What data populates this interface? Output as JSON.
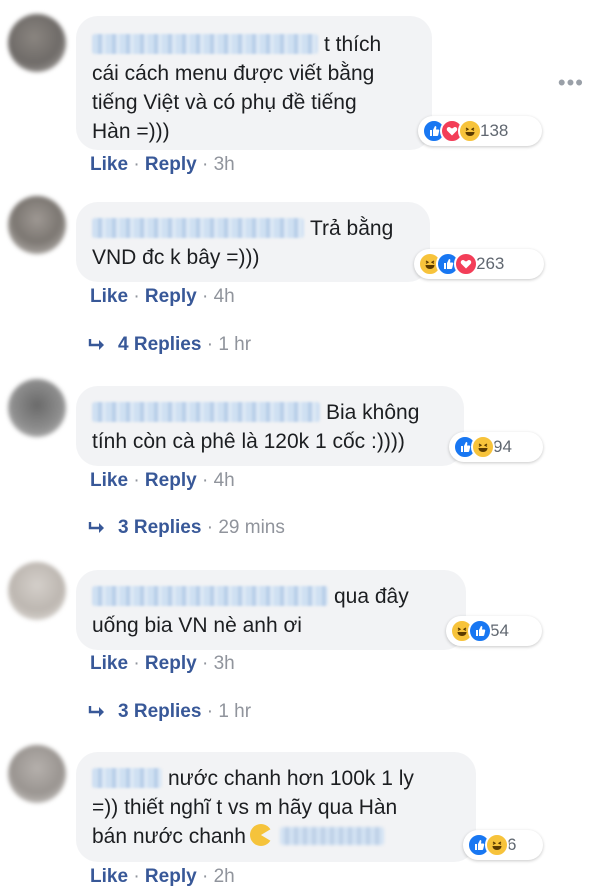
{
  "more_label": "•••",
  "comments": [
    {
      "text": "t thích cái cách menu được viết bằng tiếng Việt và có phụ đề tiếng Hàn =)))",
      "line1": "t thích",
      "line2": "cái cách menu được viết bằng",
      "line3": "tiếng Việt và có phụ đề tiếng",
      "line4": "Hàn =)))",
      "reaction_icons": [
        "like-icon",
        "love-icon",
        "haha-icon"
      ],
      "reaction_count": "138",
      "like_label": "Like",
      "reply_label": "Reply",
      "time": "3h"
    },
    {
      "text": "Trả bằng VND đc k bây =)))",
      "line1": "Trả bằng",
      "line2": "VND đc k bây =)))",
      "reaction_icons": [
        "haha-icon",
        "like-icon",
        "love-icon"
      ],
      "reaction_count": "263",
      "like_label": "Like",
      "reply_label": "Reply",
      "time": "4h",
      "replies_label": "4 Replies",
      "replies_time": "1 hr"
    },
    {
      "text": "Bia không tính còn cà phê là 120k 1 cốc :))))",
      "line1": "Bia không",
      "line2": "tính còn cà phê là 120k 1 cốc :))))",
      "reaction_icons": [
        "like-icon",
        "haha-icon"
      ],
      "reaction_count": "94",
      "like_label": "Like",
      "reply_label": "Reply",
      "time": "4h",
      "replies_label": "3 Replies",
      "replies_time": "29 mins"
    },
    {
      "text": "qua đây uống bia VN nè anh ơi",
      "line1": "qua đây",
      "line2": "uống bia VN nè anh ơi",
      "reaction_icons": [
        "haha-icon",
        "like-icon"
      ],
      "reaction_count": "54",
      "like_label": "Like",
      "reply_label": "Reply",
      "time": "3h",
      "replies_label": "3 Replies",
      "replies_time": "1 hr"
    },
    {
      "text": "nước chanh hơn 100k 1 ly =)) thiết nghĩ t vs m hãy qua Hàn bán nước chanh",
      "line1": "nước chanh hơn 100k 1 ly",
      "line2": "=)) thiết nghĩ t vs m hãy qua Hàn",
      "line3": "bán nước chanh",
      "reaction_icons": [
        "like-icon",
        "haha-icon"
      ],
      "reaction_count": "6",
      "like_label": "Like",
      "reply_label": "Reply",
      "time": "2h"
    }
  ],
  "colors": {
    "link": "#385898",
    "meta": "#90949c",
    "bubble": "#f2f3f5",
    "like": "#1877f2",
    "love": "#f33e58",
    "haha": "#f7c33b"
  }
}
